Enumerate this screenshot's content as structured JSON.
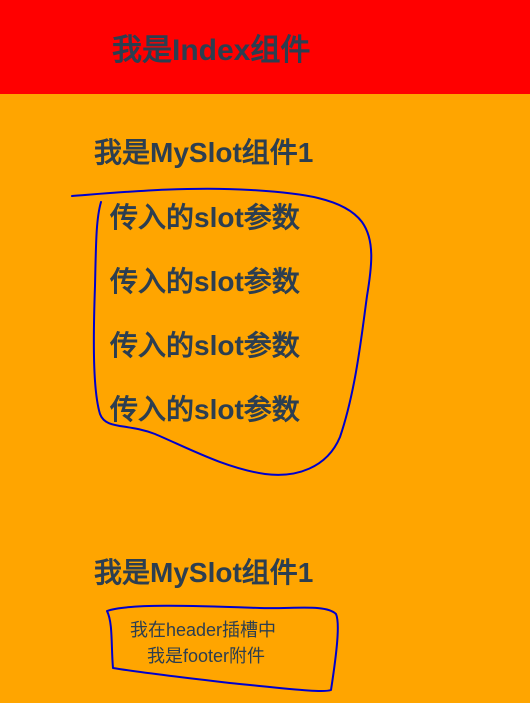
{
  "app": {
    "index_title": "我是Index组件"
  },
  "slot_section_1": {
    "title": "我是MySlot组件1",
    "items": [
      "传入的slot参数",
      "传入的slot参数",
      "传入的slot参数",
      "传入的slot参数"
    ]
  },
  "slot_section_2": {
    "title": "我是MySlot组件1",
    "header_slot_text": "我在header插槽中",
    "footer_slot_text": "我是footer附件"
  },
  "colors": {
    "header_background": "#ff0000",
    "page_background": "#ffa500",
    "text": "#2c3e50",
    "annotation_stroke": "#0000cc"
  }
}
